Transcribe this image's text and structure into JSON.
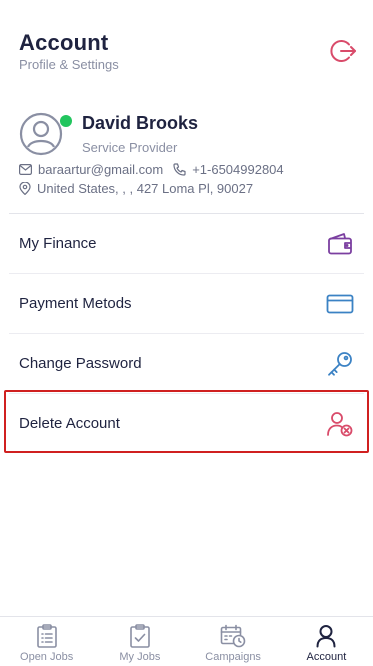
{
  "header": {
    "title": "Account",
    "subtitle": "Profile & Settings",
    "logout_icon": "logout-icon",
    "accent": "#d94b6a"
  },
  "profile": {
    "name": "David Brooks",
    "role": "Service Provider",
    "email": "baraartur@gmail.com",
    "phone": "+1-6504992804",
    "address": "United States, , , 427 Loma Pl, 90027",
    "online_color": "#22c55e"
  },
  "menu": {
    "items": [
      {
        "label": "My Finance",
        "icon": "wallet-icon",
        "color": "#7b3fa0"
      },
      {
        "label": "Payment Metods",
        "icon": "card-icon",
        "color": "#3b82c4"
      },
      {
        "label": "Change Password",
        "icon": "key-icon",
        "color": "#3b82c4"
      },
      {
        "label": "Delete Account",
        "icon": "user-remove-icon",
        "color": "#d94b6a"
      }
    ]
  },
  "tabbar": {
    "tabs": [
      {
        "label": "Open Jobs",
        "icon": "clipboard-list-icon",
        "active": false
      },
      {
        "label": "My Jobs",
        "icon": "clipboard-check-icon",
        "active": false
      },
      {
        "label": "Campaigns",
        "icon": "calendar-clock-icon",
        "active": false
      },
      {
        "label": "Account",
        "icon": "user-icon",
        "active": true
      }
    ]
  }
}
